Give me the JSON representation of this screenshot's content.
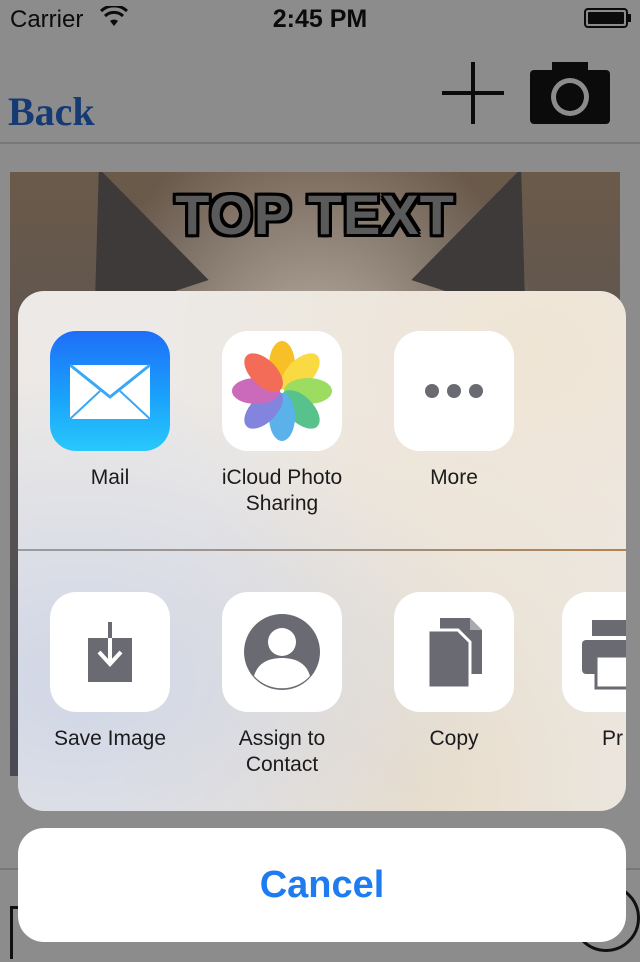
{
  "status_bar": {
    "carrier": "Carrier",
    "time": "2:45 PM"
  },
  "nav_bar": {
    "back_label": "Back",
    "add_icon": "plus-icon",
    "camera_icon": "camera-icon"
  },
  "meme": {
    "top_text": "TOP TEXT"
  },
  "share_sheet": {
    "apps": [
      {
        "label": "Mail",
        "icon": "mail-icon"
      },
      {
        "label": "iCloud Photo\nSharing",
        "icon": "photos-icon"
      },
      {
        "label": "More",
        "icon": "more-icon"
      }
    ],
    "actions": [
      {
        "label": "Save Image",
        "icon": "save-image-icon"
      },
      {
        "label": "Assign to\nContact",
        "icon": "contact-icon"
      },
      {
        "label": "Copy",
        "icon": "copy-icon"
      },
      {
        "label": "Pr",
        "icon": "print-icon"
      }
    ],
    "cancel_label": "Cancel"
  },
  "colors": {
    "accent_blue": "#1e7cf0",
    "back_text": "#163a73",
    "dim_background": "#8c8c8c",
    "icon_gray": "#6a6a72"
  }
}
